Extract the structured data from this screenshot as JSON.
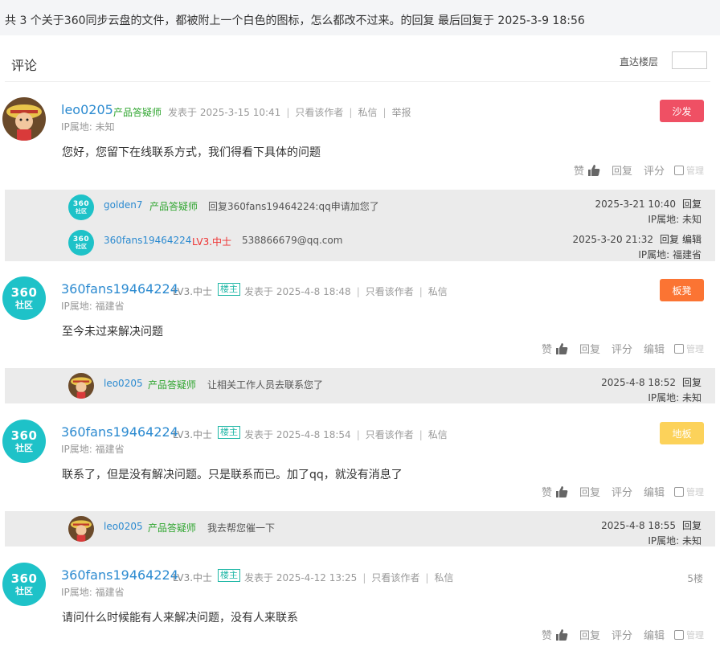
{
  "topbar": {
    "text": "共 3 个关于360同步云盘的文件，都被附上一个白色的图标，怎么都改不过来。的回复 最后回复于 2025-3-9 18:56"
  },
  "section": {
    "title": "评论",
    "jump_label": "直达楼层"
  },
  "posts": [
    {
      "username": "leo0205",
      "role": "产品答疑师",
      "time": "发表于 2025-3-15 10:41",
      "only_author": "只看该作者",
      "message": "私信",
      "report": "举报",
      "ip": "IP属地: 未知",
      "content": "您好，您留下在线联系方式，我们得看下具体的问题",
      "floor": "沙发",
      "actions": {
        "like": "赞",
        "reply": "回复",
        "rate": "评分",
        "manage": "管理"
      },
      "replies": [
        {
          "username": "golden7",
          "role": "产品答疑师",
          "text": "回复360fans19464224:qq申请加您了",
          "time": "2025-3-21 10:40",
          "reply": "回复",
          "ip": "IP属地: 未知"
        },
        {
          "username": "360fans19464224",
          "level": "LV3.中士",
          "text": "538866679@qq.com",
          "time": "2025-3-20 21:32",
          "reply": "回复",
          "edit": "编辑",
          "ip": "IP属地: 福建省"
        }
      ]
    },
    {
      "username": "360fans19464224",
      "level": "LV3.中士",
      "op_badge": "楼主",
      "time": "发表于 2025-4-8 18:48",
      "only_author": "只看该作者",
      "message": "私信",
      "ip": "IP属地: 福建省",
      "content": "至今未过来解决问题",
      "floor": "板凳",
      "actions": {
        "like": "赞",
        "reply": "回复",
        "rate": "评分",
        "edit": "编辑",
        "manage": "管理"
      },
      "replies": [
        {
          "username": "leo0205",
          "role": "产品答疑师",
          "text": "让相关工作人员去联系您了",
          "time": "2025-4-8 18:52",
          "reply": "回复",
          "ip": "IP属地: 未知"
        }
      ]
    },
    {
      "username": "360fans19464224",
      "level": "LV3.中士",
      "op_badge": "楼主",
      "time": "发表于 2025-4-8 18:54",
      "only_author": "只看该作者",
      "message": "私信",
      "ip": "IP属地: 福建省",
      "content": "联系了，但是没有解决问题。只是联系而已。加了qq，就没有消息了",
      "floor": "地板",
      "actions": {
        "like": "赞",
        "reply": "回复",
        "rate": "评分",
        "edit": "编辑",
        "manage": "管理"
      },
      "replies": [
        {
          "username": "leo0205",
          "role": "产品答疑师",
          "text": "我去帮您催一下",
          "time": "2025-4-8 18:55",
          "reply": "回复",
          "ip": "IP属地: 未知"
        }
      ]
    },
    {
      "username": "360fans19464224",
      "level": "LV3.中士",
      "op_badge": "楼主",
      "time": "发表于 2025-4-12 13:25",
      "only_author": "只看该作者",
      "message": "私信",
      "ip": "IP属地: 福建省",
      "content": "请问什么时候能有人来解决问题，没有人来联系",
      "floor": "5楼",
      "actions": {
        "like": "赞",
        "reply": "回复",
        "rate": "评分",
        "edit": "编辑",
        "manage": "管理"
      }
    }
  ],
  "logo360": {
    "num": "360",
    "text": "社区"
  },
  "colors": {
    "sofa": "#ef5064",
    "bench": "#fb7433",
    "floor": "#fcd25a",
    "link": "#2b8ad0",
    "role": "#2fa52f",
    "badge": "#1fb7a6"
  }
}
